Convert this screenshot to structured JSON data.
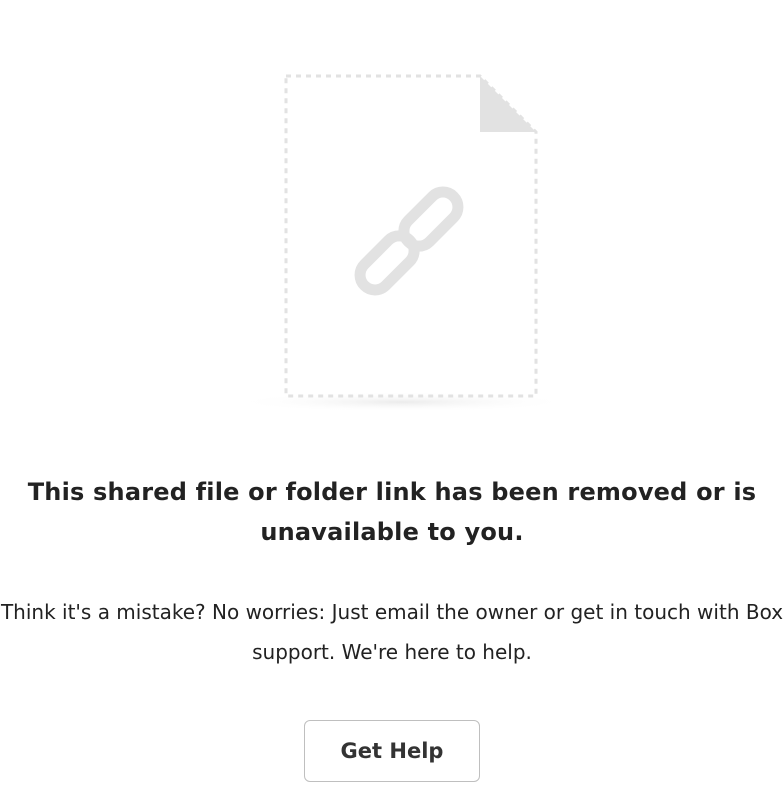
{
  "message": {
    "headline": "This shared file or folder link has been removed or is unavailable to you.",
    "body": "Think it's a mistake? No worries: Just email the owner or get in touch with Box support. We're here to help."
  },
  "actions": {
    "help_label": "Get Help"
  },
  "icons": {
    "illustration": "broken-document-icon",
    "link": "link-chain-icon"
  },
  "colors": {
    "illustration_gray": "#e2e2e2",
    "text": "#222222",
    "button_border": "#bfbfbf",
    "background": "#ffffff"
  }
}
